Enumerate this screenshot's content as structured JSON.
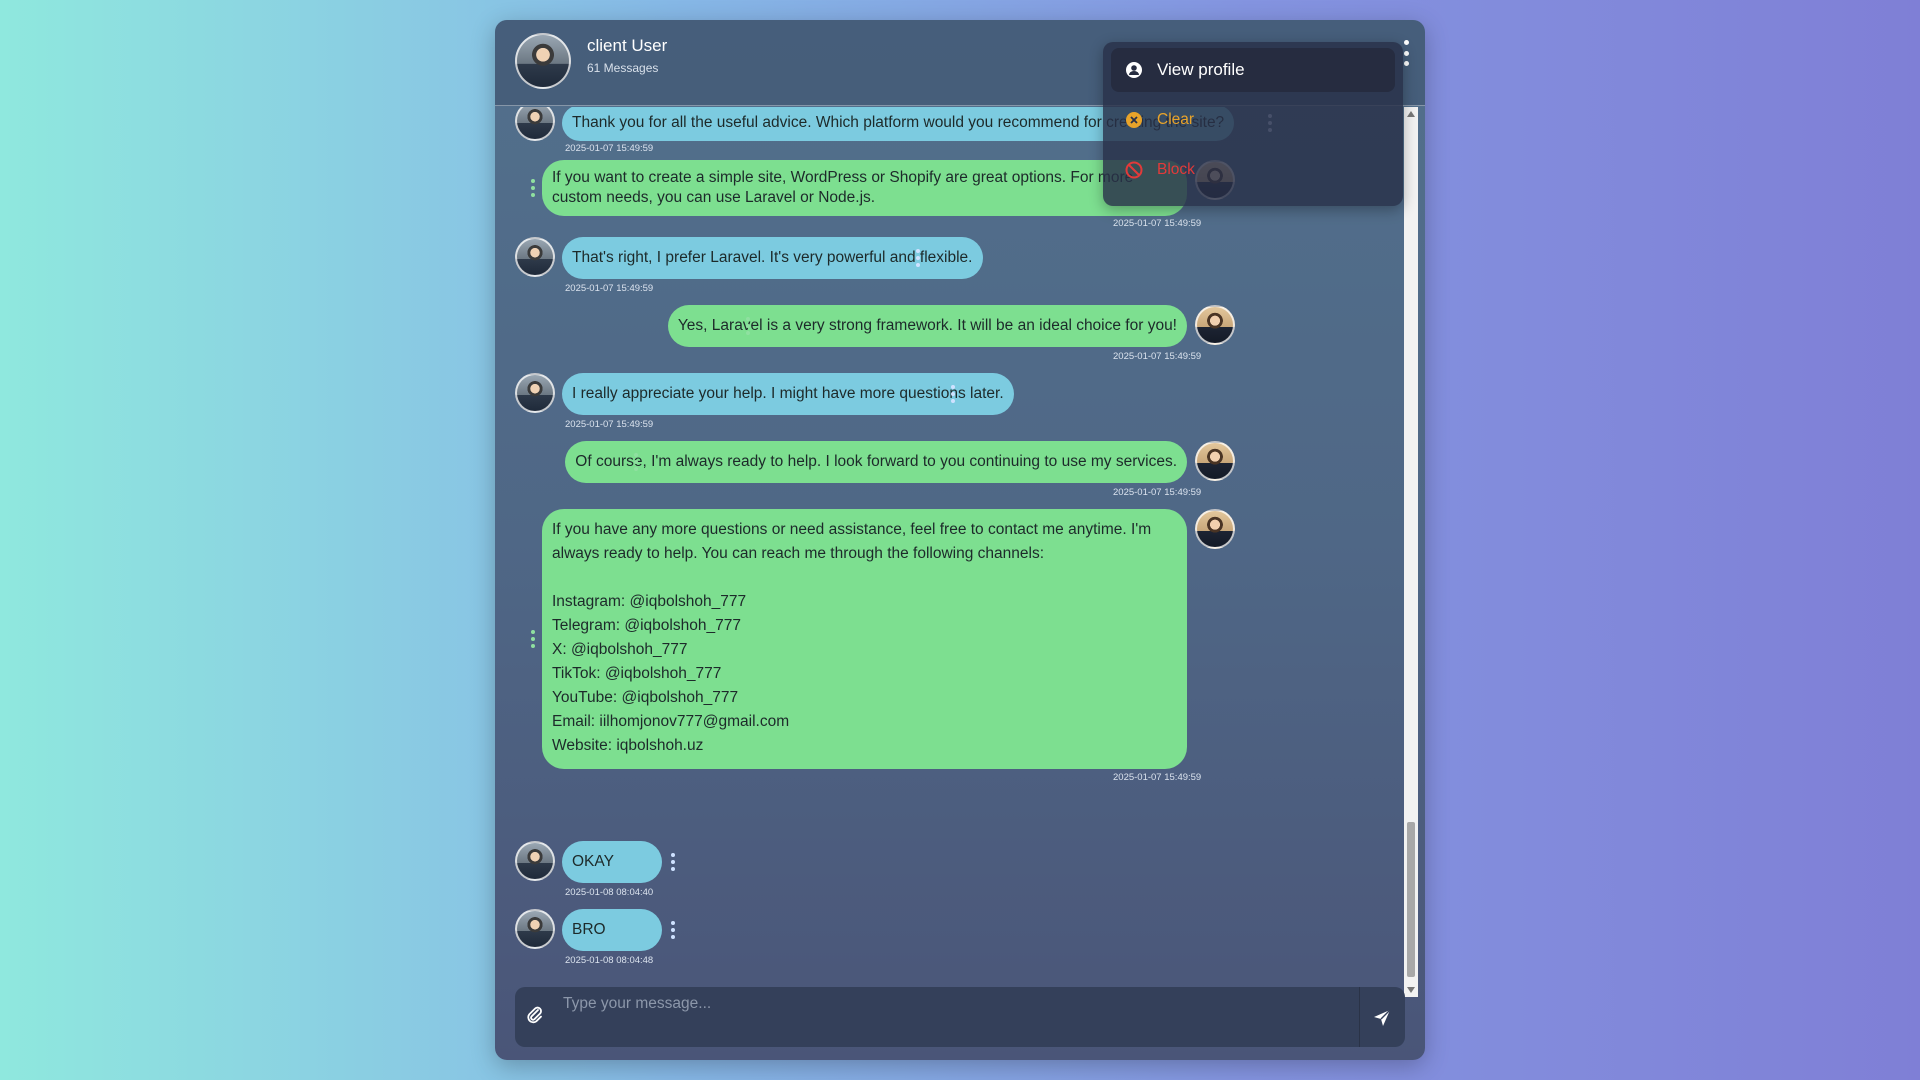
{
  "header": {
    "name": "client User",
    "message_count": "61 Messages"
  },
  "menu": {
    "view_profile": "View profile",
    "clear": "Clear",
    "block": "Block"
  },
  "messages": [
    {
      "side": "in",
      "text": "Thank you for all the useful advice. Which platform would you recommend for creating the site?",
      "time": "2025-01-07 15:49:59"
    },
    {
      "side": "out",
      "text": "If you want to create a simple site, WordPress or Shopify are great options. For more custom needs, you can use Laravel or Node.js.",
      "time": "2025-01-07 15:49:59"
    },
    {
      "side": "in",
      "text": "That's right, I prefer Laravel. It's very powerful and flexible.",
      "time": "2025-01-07 15:49:59"
    },
    {
      "side": "out",
      "text": "Yes, Laravel is a very strong framework. It will be an ideal choice for you!",
      "time": "2025-01-07 15:49:59"
    },
    {
      "side": "in",
      "text": "I really appreciate your help. I might have more questions later.",
      "time": "2025-01-07 15:49:59"
    },
    {
      "side": "out",
      "text": "Of course, I'm always ready to help. I look forward to you continuing to use my services.",
      "time": "2025-01-07 15:49:59"
    },
    {
      "side": "out",
      "text": "If you have any more questions or need assistance, feel free to contact me anytime. I'm always ready to help. You can reach me through the following channels:\n\nInstagram: @iqbolshoh_777\nTelegram: @iqbolshoh_777\nX: @iqbolshoh_777\nTikTok: @iqbolshoh_777\nYouTube: @iqbolshoh_777\nEmail: iilhomjonov777@gmail.com\nWebsite: iqbolshoh.uz",
      "time": "2025-01-07 15:49:59"
    },
    {
      "side": "in",
      "text": "OKAY",
      "time": "2025-01-08 08:04:40"
    },
    {
      "side": "in",
      "text": "BRO",
      "time": "2025-01-08 08:04:48"
    }
  ],
  "composer": {
    "placeholder": "Type your message..."
  },
  "colors": {
    "incoming_bubble": "#7ccbe0",
    "outgoing_bubble": "#7ddf90",
    "clear_text": "#e8a32a",
    "block_text": "#e23a3a"
  },
  "icons": {
    "attach": "paperclip-icon",
    "send": "paper-plane-icon",
    "profile": "user-circle-icon",
    "clear": "x-circle-icon",
    "block": "ban-icon",
    "menu": "vertical-dots-icon"
  }
}
